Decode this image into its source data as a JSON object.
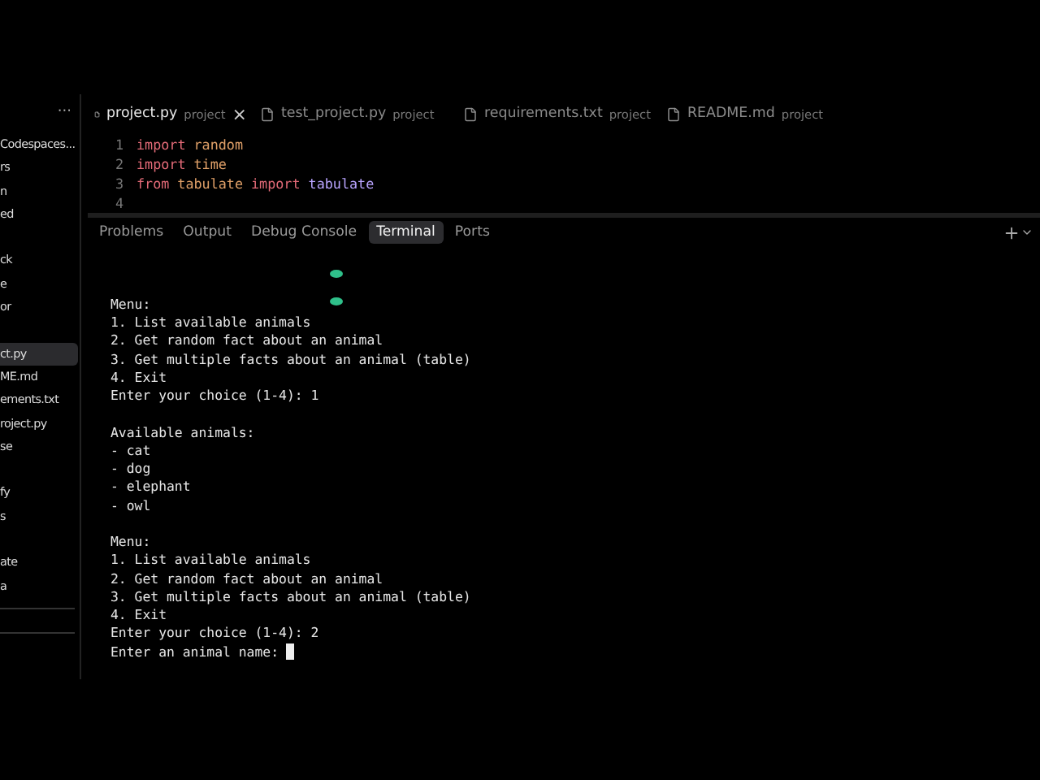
{
  "sidebar": {
    "more": "···",
    "groups": [
      [
        {
          "label": "Codespaces...",
          "selected": false
        },
        {
          "label": "rs",
          "selected": false
        },
        {
          "label": "n",
          "selected": false
        },
        {
          "label": "ed",
          "selected": false
        }
      ],
      [
        {
          "label": "ck",
          "selected": false
        },
        {
          "label": "e",
          "selected": false
        },
        {
          "label": "or",
          "selected": false
        }
      ],
      [
        {
          "label": "ct.py",
          "selected": true
        },
        {
          "label": "ME.md",
          "selected": false
        },
        {
          "label": "ements.txt",
          "selected": false
        },
        {
          "label": "roject.py",
          "selected": false
        },
        {
          "label": "se",
          "selected": false
        }
      ],
      [
        {
          "label": "fy",
          "selected": false
        },
        {
          "label": "s",
          "selected": false
        }
      ],
      [
        {
          "label": "ate",
          "selected": false
        },
        {
          "label": "a",
          "selected": false
        }
      ]
    ]
  },
  "editor_tabs": [
    {
      "name": "project.py",
      "folder": "project",
      "selected": true,
      "close": "×"
    },
    {
      "name": "test_project.py",
      "folder": "project",
      "selected": false
    },
    {
      "name": "requirements.txt",
      "folder": "project",
      "selected": false
    },
    {
      "name": "README.md",
      "folder": "project",
      "selected": false
    }
  ],
  "code_lines": [
    {
      "number": "1",
      "tokens": [
        {
          "text": "import",
          "kind": "keyword"
        },
        {
          "text": "random",
          "kind": "module"
        }
      ]
    },
    {
      "number": "2",
      "tokens": [
        {
          "text": "import",
          "kind": "keyword"
        },
        {
          "text": "time",
          "kind": "module"
        }
      ]
    },
    {
      "number": "3",
      "tokens": [
        {
          "text": "from",
          "kind": "keyword"
        },
        {
          "text": "tabulate",
          "kind": "module"
        },
        {
          "text": "import",
          "kind": "keyword"
        },
        {
          "text": "tabulate",
          "kind": "name"
        }
      ]
    },
    {
      "number": "4"
    }
  ],
  "panel_tabs": [
    {
      "label": "Problems",
      "selected": false
    },
    {
      "label": "Output",
      "selected": false
    },
    {
      "label": "Debug Console",
      "selected": false
    },
    {
      "label": "Terminal",
      "selected": true
    },
    {
      "label": "Ports",
      "selected": false
    }
  ],
  "terminal": {
    "blocks": [
      [
        "Menu:",
        "1. List available animals",
        "2. Get random fact about an animal",
        "3. Get multiple facts about an animal (table)",
        "4. Exit",
        "Enter your choice (1-4): 1"
      ],
      [
        "Available animals:",
        "- cat",
        "- dog",
        "- elephant",
        "- owl"
      ],
      [
        "Menu:",
        "1. List available animals",
        "2. Get random fact about an animal",
        "3. Get multiple facts about an animal (table)",
        "4. Exit",
        "Enter your choice (1-4): 2",
        "Enter an animal name: "
      ]
    ],
    "cursor": true
  }
}
